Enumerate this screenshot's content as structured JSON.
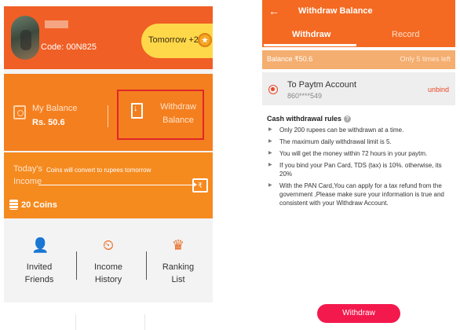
{
  "left": {
    "profile": {
      "code_label": "Code: 00N825"
    },
    "tomorrow": {
      "label": "Tomorrow +25"
    },
    "balance": {
      "label": "My Balance",
      "value": "Rs. 50.6",
      "withdraw_label_line1": "Withdraw",
      "withdraw_label_line2": "Balance"
    },
    "income": {
      "label_line1": "Today's",
      "label_line2": "Income",
      "note": "Coins will convert to rupees tomorrow",
      "coins": "20 Coins"
    },
    "menu": [
      {
        "line1": "Invited",
        "line2": "Friends"
      },
      {
        "line1": "Income",
        "line2": "History"
      },
      {
        "line1": "Ranking",
        "line2": "List"
      }
    ],
    "colors": {
      "header": "#f05f25",
      "balance": "#f47f1f",
      "income": "#f58a1f",
      "highlight_box": "#e0262a"
    }
  },
  "right": {
    "title": "Withdraw Balance",
    "tabs": [
      {
        "label": "Withdraw"
      },
      {
        "label": "Record"
      }
    ],
    "balance_label": "Balance ₹50.6",
    "times_left": "Only 5 times left",
    "account": {
      "name": "To Paytm Account",
      "number": "860****549",
      "unbind": "unbind"
    },
    "rules_title": "Cash withdrawal rules",
    "rules": [
      "Only 200 rupees can be withdrawn at a time.",
      "The maximum daily withdrawal limit is 5.",
      "You will get the money within 72 hours in your paytm.",
      "If you bind your Pan Card, TDS (tax) is 10%. otherwise, its 20%",
      "With the PAN Card,You can apply for a tax refund from the government ,Please make sure your information is true and consistent with your Withdraw Account."
    ],
    "button": "Withdraw",
    "colors": {
      "header": "#f46a22",
      "balance_bar": "#f4ae70",
      "button": "#f3194d"
    }
  }
}
